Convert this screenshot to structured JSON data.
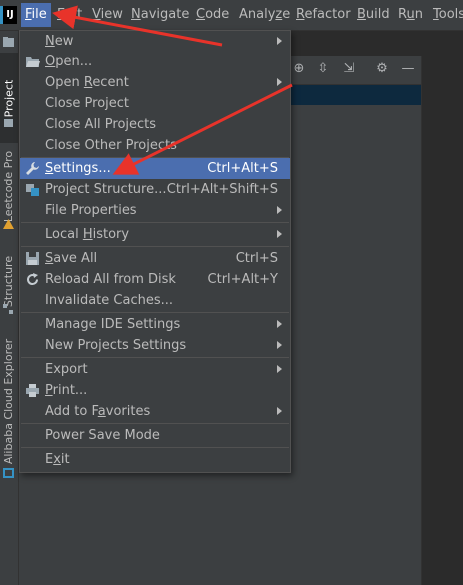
{
  "app": {
    "logo": "IJ"
  },
  "menubar": {
    "items": [
      {
        "label": "File",
        "mn": "F",
        "rest": "ile",
        "active": true
      },
      {
        "label": "Edit",
        "mn": "E",
        "rest": "dit"
      },
      {
        "label": "View",
        "mn": "V",
        "rest": "iew"
      },
      {
        "label": "Navigate",
        "mn": "N",
        "rest": "avigate"
      },
      {
        "label": "Code",
        "mn": "C",
        "rest": "ode"
      },
      {
        "label": "Analyze",
        "pre": "Analy",
        "mn": "z",
        "rest": "e"
      },
      {
        "label": "Refactor",
        "mn": "R",
        "rest": "efactor"
      },
      {
        "label": "Build",
        "mn": "B",
        "rest": "uild"
      },
      {
        "label": "Run",
        "pre": "R",
        "mn": "u",
        "rest": "n"
      },
      {
        "label": "Tools",
        "mn": "T",
        "rest": "ools"
      }
    ]
  },
  "left_strip": {
    "tabs": [
      "Project",
      "Leetcode Pro",
      "Structure",
      "Alibaba Cloud Explorer"
    ]
  },
  "file_menu": {
    "items": [
      {
        "label": "New",
        "submenu": true
      },
      {
        "label": "Open...",
        "icon": "folder-open-icon"
      },
      {
        "label": "Open Recent",
        "submenu": true
      },
      {
        "label": "Close Project"
      },
      {
        "label": "Close All Projects"
      },
      {
        "label": "Close Other Projects"
      },
      {
        "label": "Settings...",
        "shortcut": "Ctrl+Alt+S",
        "icon": "wrench-icon",
        "selected": true
      },
      {
        "label": "Project Structure...",
        "shortcut": "Ctrl+Alt+Shift+S",
        "icon": "project-structure-icon"
      },
      {
        "label": "File Properties",
        "submenu": true
      },
      {
        "label": "Local History",
        "submenu": true
      },
      {
        "label": "Save All",
        "shortcut": "Ctrl+S",
        "icon": "save-icon"
      },
      {
        "label": "Reload All from Disk",
        "shortcut": "Ctrl+Alt+Y",
        "icon": "reload-icon"
      },
      {
        "label": "Invalidate Caches..."
      },
      {
        "label": "Manage IDE Settings",
        "submenu": true
      },
      {
        "label": "New Projects Settings",
        "submenu": true
      },
      {
        "label": "Export",
        "submenu": true
      },
      {
        "label": "Print...",
        "icon": "printer-icon"
      },
      {
        "label": "Add to Favorites",
        "submenu": true
      },
      {
        "label": "Power Save Mode"
      },
      {
        "label": "Exit"
      }
    ]
  },
  "colors": {
    "menu_bg": "#3c3f41",
    "selection": "#4b6eaf",
    "annotation_arrow": "#e8332a"
  }
}
